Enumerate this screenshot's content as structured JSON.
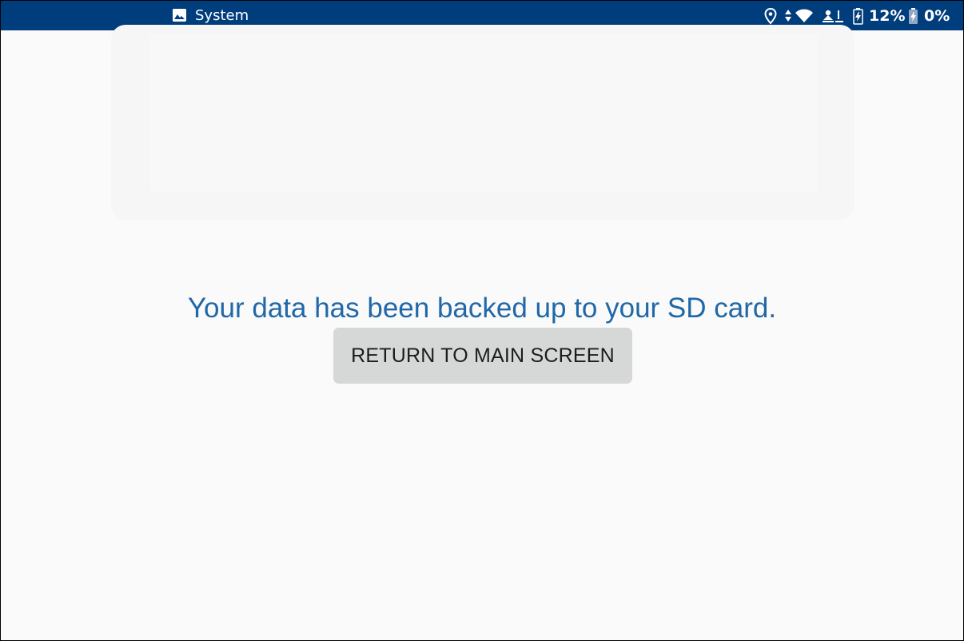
{
  "status_bar": {
    "app_name": "System",
    "notification_icon": "image-icon",
    "icons": [
      "location-icon",
      "data-arrows-icon",
      "wifi-icon",
      "hotspot-icon",
      "battery-icon",
      "battery-charging-icon"
    ],
    "battery_primary": "12%",
    "battery_secondary": "0%",
    "background_color": "#003d7c"
  },
  "background_card": {
    "line1": "",
    "line2": "",
    "line3": ""
  },
  "main": {
    "message": "Your data has been backed up to your SD card.",
    "message_color": "#2068a8",
    "return_button_label": "RETURN TO MAIN SCREEN"
  }
}
